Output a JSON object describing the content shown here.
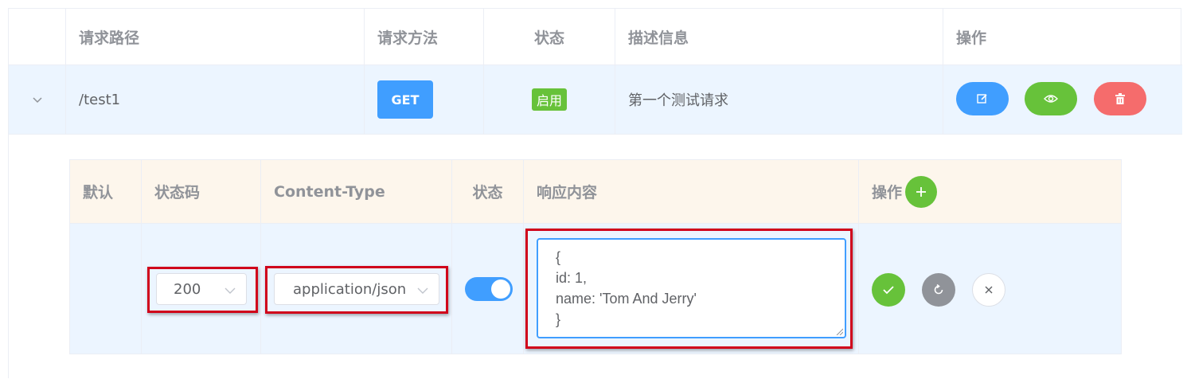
{
  "outer_table": {
    "headers": [
      "",
      "请求路径",
      "请求方法",
      "状态",
      "描述信息",
      "操作"
    ],
    "row": {
      "path": "/test1",
      "method": "GET",
      "status": "启用",
      "description": "第一个测试请求"
    },
    "actions": [
      "edit-icon",
      "eye-icon",
      "trash-icon"
    ]
  },
  "inner_table": {
    "headers": [
      "默认",
      "状态码",
      "Content-Type",
      "状态",
      "响应内容",
      "操作"
    ],
    "row": {
      "status_code": "200",
      "content_type": "application/json",
      "enabled": true,
      "response_lines": [
        "{",
        "id: 1,",
        "name: 'Tom And Jerry'",
        "}"
      ]
    }
  },
  "colors": {
    "primary": "#409eff",
    "success": "#67c23a",
    "danger": "#f56c6c",
    "info": "#909399",
    "highlight_box": "#d0021b"
  }
}
